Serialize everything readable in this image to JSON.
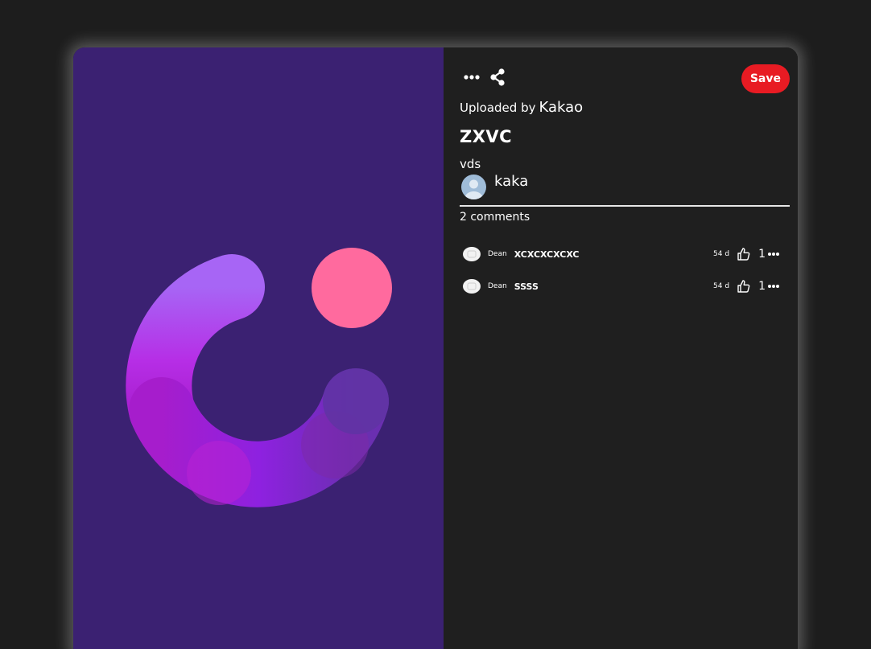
{
  "colors": {
    "page_background": "#1d1d1d",
    "panel_background": "#1f1f1f",
    "media_background": "#3b2172",
    "save_button": "#e81b23",
    "divider": "#e6e6e6"
  },
  "toolbar": {
    "more_icon": "more-horizontal-icon",
    "share_icon": "share-icon",
    "save_label": "Save"
  },
  "pin": {
    "uploaded_by_label": "Uploaded by",
    "owner": "Kakao",
    "title": "ZXVC",
    "description": "vds",
    "author": "kaka"
  },
  "comments": {
    "count_label": "2 comments",
    "items": [
      {
        "user": "Dean",
        "text": "XCXCXCXCXC",
        "age": "54 d",
        "likes": "1"
      },
      {
        "user": "Dean",
        "text": "SSSS",
        "age": "54 d",
        "likes": "1"
      }
    ]
  }
}
